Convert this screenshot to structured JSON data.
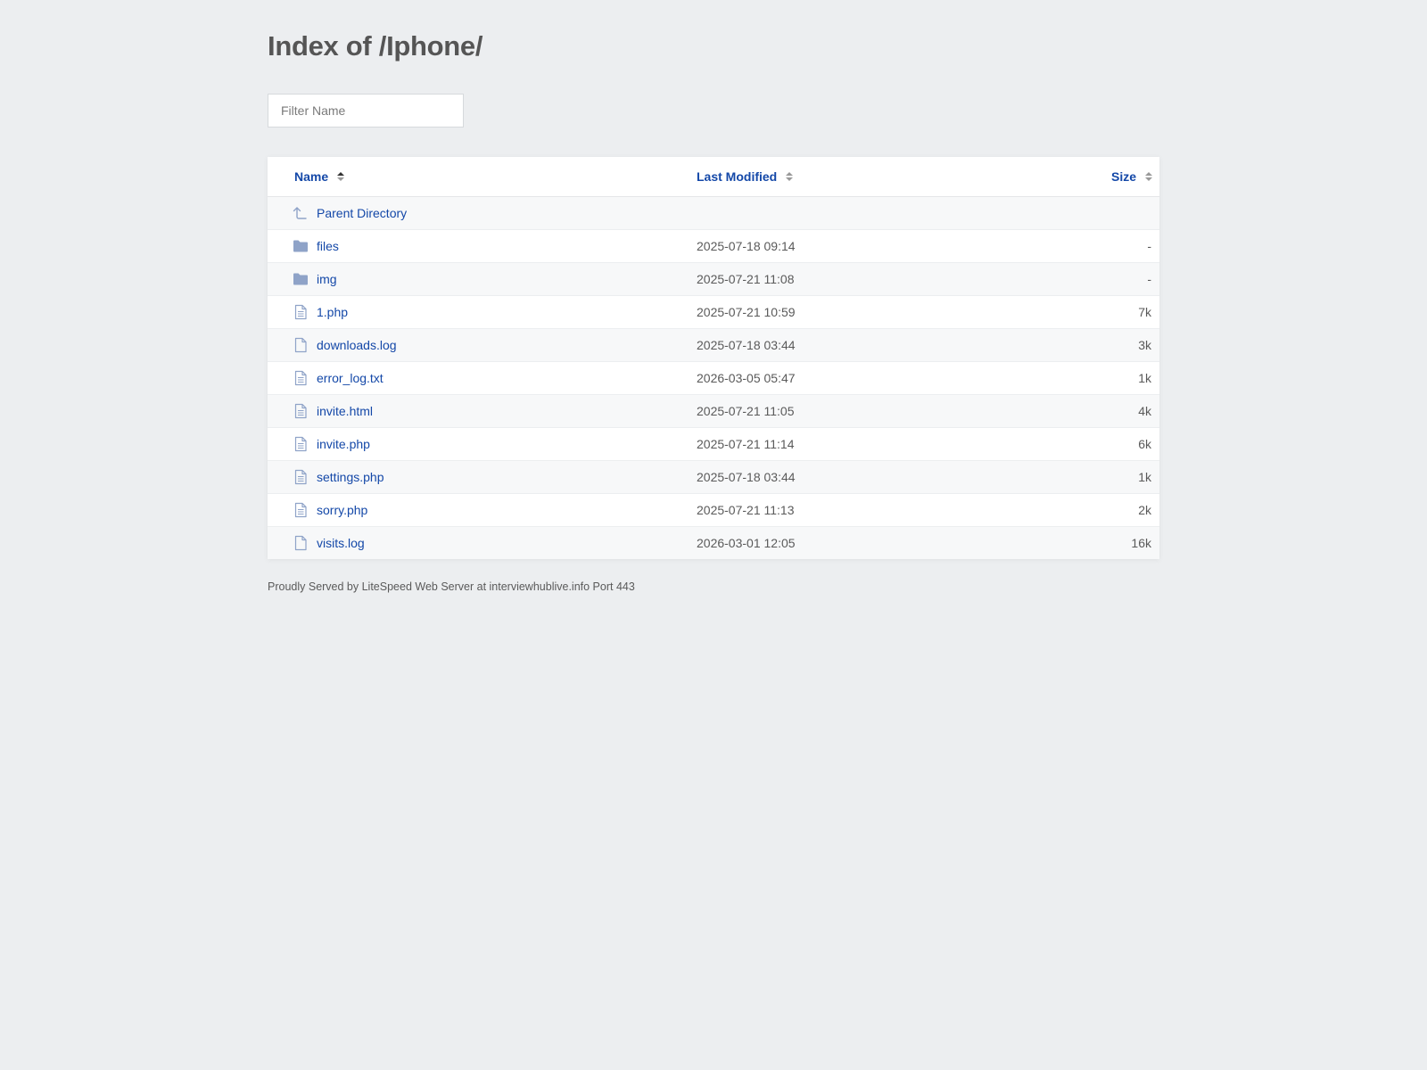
{
  "page": {
    "title": "Index of /Iphone/"
  },
  "filter": {
    "placeholder": "Filter Name",
    "value": ""
  },
  "table": {
    "headers": {
      "name": "Name",
      "modified": "Last Modified",
      "size": "Size"
    },
    "parent": {
      "label": "Parent Directory",
      "icon": "arrow-up-icon"
    },
    "rows": [
      {
        "name": "files",
        "modified": "2025-07-18 09:14",
        "size": "-",
        "icon": "folder-icon"
      },
      {
        "name": "img",
        "modified": "2025-07-21 11:08",
        "size": "-",
        "icon": "folder-icon"
      },
      {
        "name": "1.php",
        "modified": "2025-07-21 10:59",
        "size": "7k",
        "icon": "text-file-icon"
      },
      {
        "name": "downloads.log",
        "modified": "2025-07-18 03:44",
        "size": "3k",
        "icon": "blank-file-icon"
      },
      {
        "name": "error_log.txt",
        "modified": "2026-03-05 05:47",
        "size": "1k",
        "icon": "text-file-icon"
      },
      {
        "name": "invite.html",
        "modified": "2025-07-21 11:05",
        "size": "4k",
        "icon": "text-file-icon"
      },
      {
        "name": "invite.php",
        "modified": "2025-07-21 11:14",
        "size": "6k",
        "icon": "text-file-icon"
      },
      {
        "name": "settings.php",
        "modified": "2025-07-18 03:44",
        "size": "1k",
        "icon": "text-file-icon"
      },
      {
        "name": "sorry.php",
        "modified": "2025-07-21 11:13",
        "size": "2k",
        "icon": "text-file-icon"
      },
      {
        "name": "visits.log",
        "modified": "2026-03-01 12:05",
        "size": "16k",
        "icon": "blank-file-icon"
      }
    ]
  },
  "footer": {
    "text": "Proudly Served by LiteSpeed Web Server at interviewhublive.info Port 443"
  },
  "colors": {
    "background": "#eceef0",
    "link": "#1448a8",
    "text": "#5a5a5a",
    "icon": "#8fa3c8"
  }
}
